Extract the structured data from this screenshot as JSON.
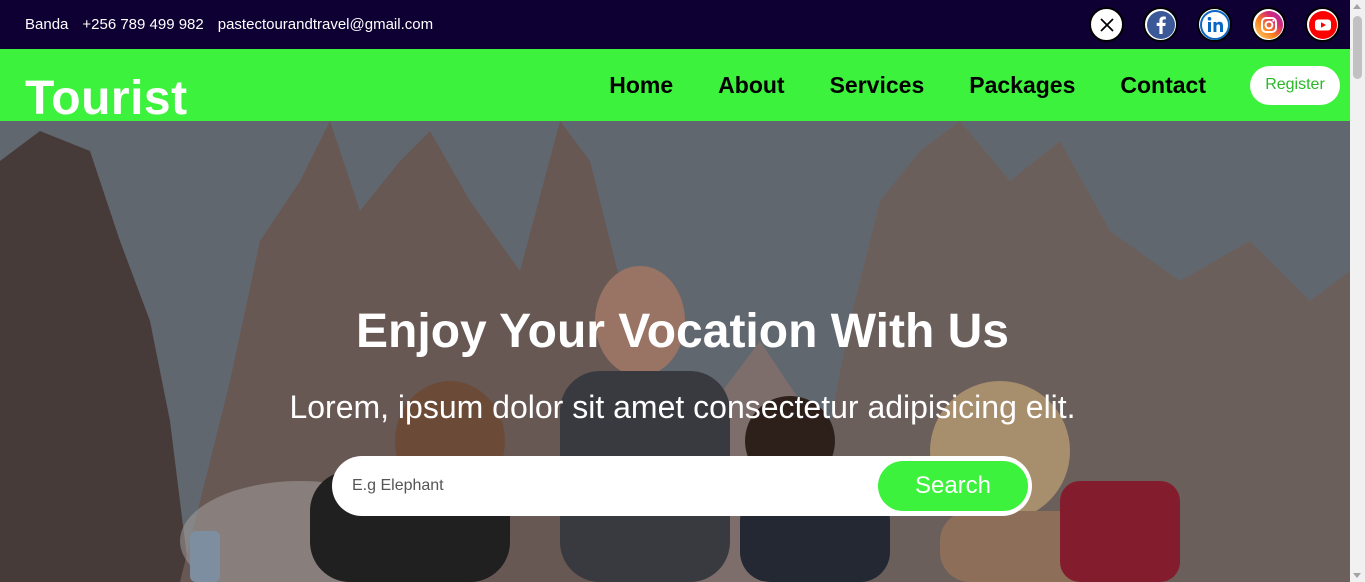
{
  "topbar": {
    "name": "Banda",
    "phone": "+256 789 499 982",
    "email": "pastectourandtravel@gmail.com",
    "socials": [
      {
        "icon": "x-icon",
        "color": "#000000"
      },
      {
        "icon": "facebook-icon",
        "color": "#3b5998"
      },
      {
        "icon": "linkedin-icon",
        "color": "#0a66c2"
      },
      {
        "icon": "instagram-icon",
        "color": "#e1306c"
      },
      {
        "icon": "youtube-icon",
        "color": "#ff0000"
      }
    ]
  },
  "nav": {
    "logo": "Tourist",
    "links": [
      "Home",
      "About",
      "Services",
      "Packages",
      "Contact"
    ],
    "register_label": "Register"
  },
  "hero": {
    "title": "Enjoy Your Vocation With Us",
    "subtitle": "Lorem, ipsum dolor sit amet consectetur adipisicing elit.",
    "search_placeholder": "E.g Elephant",
    "search_button": "Search"
  },
  "colors": {
    "topbar_bg": "#0f0033",
    "accent_green": "#3cf23c",
    "white": "#ffffff"
  }
}
